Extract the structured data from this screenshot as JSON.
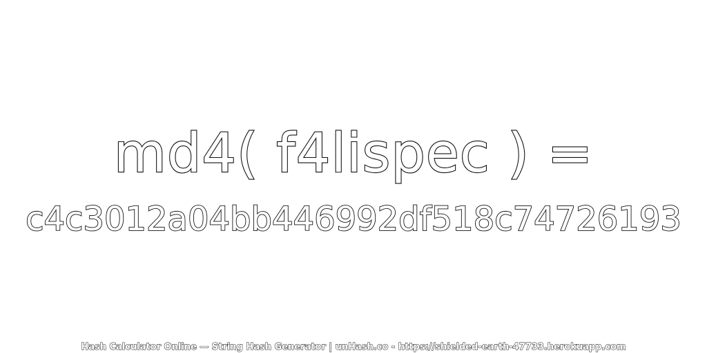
{
  "heading": {
    "expression": "md4( f4lispec ) =",
    "hash": "c4c3012a04bb446992df518c74726193"
  },
  "footer": {
    "text": "Hash Calculator Online — String Hash Generator | unHash.co - https://shielded-earth-47733.herokuapp.com"
  }
}
